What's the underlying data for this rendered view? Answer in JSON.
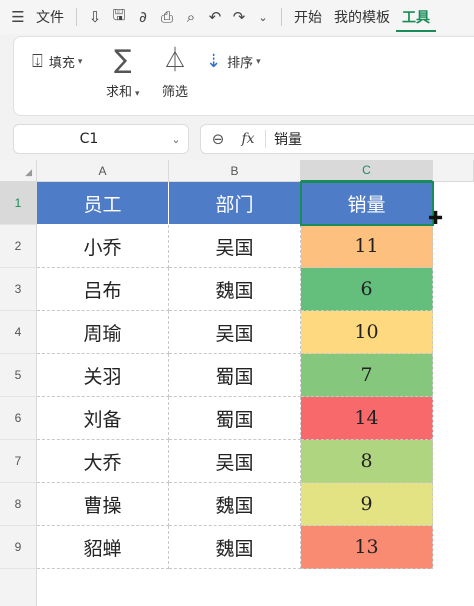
{
  "menubar": {
    "menu_icon": "hamburger-icon",
    "file_label": "文件",
    "tools": [
      "format-painter-icon",
      "save-icon",
      "link-icon",
      "print-preview-icon",
      "find-icon",
      "undo-icon",
      "redo-icon",
      "more-icon"
    ],
    "tabs": [
      {
        "label": "开始",
        "active": false
      },
      {
        "label": "我的模板",
        "active": false
      },
      {
        "label": "工具",
        "active": true
      }
    ]
  },
  "ribbon": {
    "fill_label": "填充",
    "sum_label": "求和",
    "filter_label": "筛选",
    "sort_label": "排序"
  },
  "formula": {
    "name_box": "C1",
    "value": "销量"
  },
  "sheet": {
    "columns": [
      "A",
      "B",
      "C"
    ],
    "active_column": "C",
    "active_row": 1,
    "headers": [
      "员工",
      "部门",
      "销量"
    ],
    "header_color": "#4f7cc6",
    "rows": [
      {
        "row": 2,
        "name": "小乔",
        "dept": "吴国",
        "sales": "11",
        "color": "#fec07f"
      },
      {
        "row": 3,
        "name": "吕布",
        "dept": "魏国",
        "sales": "6",
        "color": "#63bf7b"
      },
      {
        "row": 4,
        "name": "周瑜",
        "dept": "吴国",
        "sales": "10",
        "color": "#fed97f"
      },
      {
        "row": 5,
        "name": "关羽",
        "dept": "蜀国",
        "sales": "7",
        "color": "#84c77d"
      },
      {
        "row": 6,
        "name": "刘备",
        "dept": "蜀国",
        "sales": "14",
        "color": "#f8696b"
      },
      {
        "row": 7,
        "name": "大乔",
        "dept": "吴国",
        "sales": "8",
        "color": "#b0d581"
      },
      {
        "row": 8,
        "name": "曹操",
        "dept": "魏国",
        "sales": "9",
        "color": "#e3e383"
      },
      {
        "row": 9,
        "name": "貂蝉",
        "dept": "魏国",
        "sales": "13",
        "color": "#fa8b73"
      }
    ]
  }
}
